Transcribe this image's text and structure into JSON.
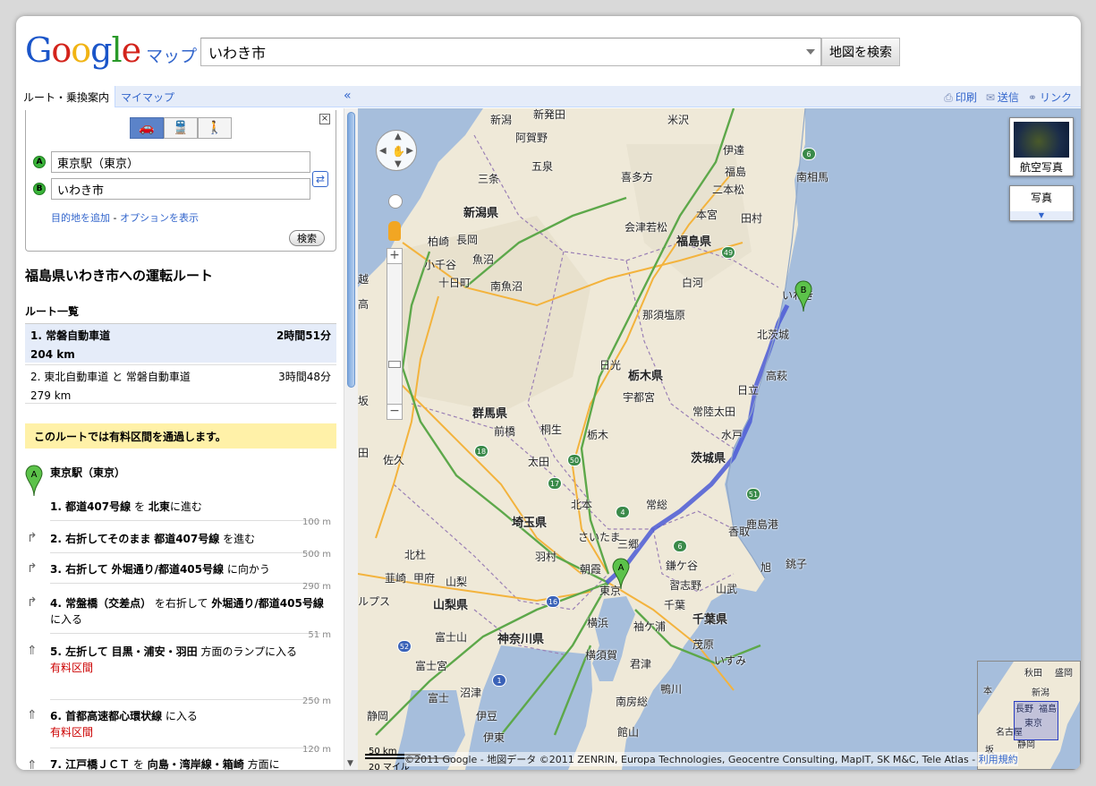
{
  "header": {
    "logo": "Google",
    "service": "マップ",
    "search_value": "いわき市",
    "search_button": "地図を検索"
  },
  "panel_bar": {
    "tab_active": "ルート・乗換案内",
    "tab_mymap": "マイマップ",
    "collapse": "«",
    "print": "印刷",
    "send": "送信",
    "link": "リンク"
  },
  "directions": {
    "from": "東京駅（東京）",
    "to": "いわき市",
    "add_destination": "目的地を追加",
    "show_options": "オプションを表示",
    "search_btn": "検索",
    "pin_a": "A",
    "pin_b": "B"
  },
  "summary": {
    "title": "福島県いわき市への運転ルート",
    "list_header": "ルート一覧",
    "routes": [
      {
        "name": "1. 常磐自動車道",
        "time": "2時間51分",
        "distance": "204 km"
      },
      {
        "name": "2. 東北自動車道 と 常磐自動車道",
        "time": "3時間48分",
        "distance": "279 km"
      }
    ],
    "toll_notice": "このルートでは有料区間を通過します。"
  },
  "steps": {
    "start_label": "東京駅（東京）",
    "s1_a": "1. 都道407号線",
    "s1_b": "を",
    "s1_c": "北東",
    "s1_d": "に進む",
    "s1_dist": "100 m",
    "s2_a": "2. 右折してそのまま",
    "s2_b": "都道407号線",
    "s2_c": "を進む",
    "s2_dist": "500 m",
    "s3_a": "3. 右折して",
    "s3_b": "外堀通り/都道405号線",
    "s3_c": "に向かう",
    "s3_dist": "290 m",
    "s4_a": "4. 常盤橋（交差点）",
    "s4_b": "を右折して",
    "s4_c": "外堀通り/都道405号線",
    "s4_d": "に入る",
    "s4_dist": "51 m",
    "s5_a": "5. 左折して",
    "s5_b": "目黒・浦安・羽田",
    "s5_c": "方面のランプに入る",
    "s5_toll": "有料区間",
    "s5_dist": "250 m",
    "s6_a": "6. 首都高速都心環状線",
    "s6_b": "に入る",
    "s6_toll": "有料区間",
    "s6_dist": "120 m",
    "s7_a": "7. 江戸橋ＪＣＴ",
    "s7_b": "を",
    "s7_c": "向島・湾岸線・箱崎",
    "s7_d": "方面に"
  },
  "map": {
    "satellite": "航空写真",
    "photo": "写真",
    "scale_km": "50 km",
    "scale_mi": "20 マイル",
    "copyright": "©2011 Google - 地図データ ©2011 ZENRIN, Europa Technologies, Geocentre Consulting, MapIT, SK M&C, Tele Atlas -",
    "terms": "利用規約",
    "marker_a": "A",
    "marker_b": "B",
    "route_color": "#4b5bd6",
    "labels": {
      "niigata_city": "新潟",
      "shibata": "新発田",
      "yonezawa": "米沢",
      "agano": "阿賀野",
      "gosen": "五泉",
      "sanjo": "三条",
      "kitakata": "喜多方",
      "date": "伊達",
      "fukushima": "福島",
      "minamisoma": "南相馬",
      "nihonmatsu": "二本松",
      "niigata_pref": "新潟県",
      "aizuwakamatsu": "会津若松",
      "motomiya": "本宮",
      "tamura": "田村",
      "fukushima_pref": "福島県",
      "kashiwazaki": "柏崎",
      "nagaoka": "長岡",
      "ojiya": "小千谷",
      "uonuma": "魚沼",
      "tokamachi": "十日町",
      "minamiuonuma": "南魚沼",
      "shirakawa": "白河",
      "iwaki": "いわき",
      "nasushiobara": "那須塩原",
      "kitaibaraki": "北茨城",
      "takahagi": "高萩",
      "nikko": "日光",
      "tochigi_pref": "栃木県",
      "utsunomiya": "宇都宮",
      "hitachi": "日立",
      "hitachiota": "常陸太田",
      "gunma_pref": "群馬県",
      "kiryu": "桐生",
      "maebashi": "前橋",
      "tochigi": "栃木",
      "mito": "水戸",
      "ibaraki_pref": "茨城県",
      "saku": "佐久",
      "ota": "太田",
      "kitamoto": "北本",
      "joso": "常総",
      "saitama_pref": "埼玉県",
      "kashima": "鹿島港",
      "katori": "香取",
      "saitama": "さいたま",
      "misato": "三郷",
      "hokuto": "北杜",
      "hamura": "羽村",
      "asaka": "朝霞",
      "kamagaya": "鎌ケ谷",
      "asahi": "旭",
      "choshi": "銚子",
      "nirasaki": "韮崎",
      "kofu": "甲府",
      "yamanashi": "山梨",
      "tokyo": "東京",
      "narashino": "習志野",
      "sanmu": "山武",
      "yamanashi_pref": "山梨県",
      "chiba": "千葉",
      "chiba_pref": "千葉県",
      "yokohama": "横浜",
      "sodegaura": "袖ケ浦",
      "fujisan": "富士山",
      "kanagawa_pref": "神奈川県",
      "mobara": "茂原",
      "yokosuka": "横須賀",
      "kimitsu": "君津",
      "isumi": "いすみ",
      "fujinomiya": "富士宮",
      "fuji": "富士",
      "numazu": "沼津",
      "kamogawa": "鴨川",
      "minamiboso": "南房総",
      "izu": "伊豆",
      "shizuoka": "静岡",
      "ito": "伊東",
      "tateyama": "館山",
      "ko": "越",
      "taka": "高",
      "saka": "坂",
      "den": "田",
      "rupusu": "ルプス"
    },
    "overview_labels": {
      "akita": "秋田",
      "morioka": "盛岡",
      "niigata": "新潟",
      "fukushima": "福島",
      "tokyo": "東京",
      "nagano": "長野",
      "nagoya": "名古屋",
      "shizuoka": "静岡",
      "hon": "本",
      "saka": "坂"
    },
    "shields": [
      "6",
      "49",
      "18",
      "50",
      "17",
      "4",
      "6",
      "51",
      "16",
      "52",
      "1"
    ]
  }
}
